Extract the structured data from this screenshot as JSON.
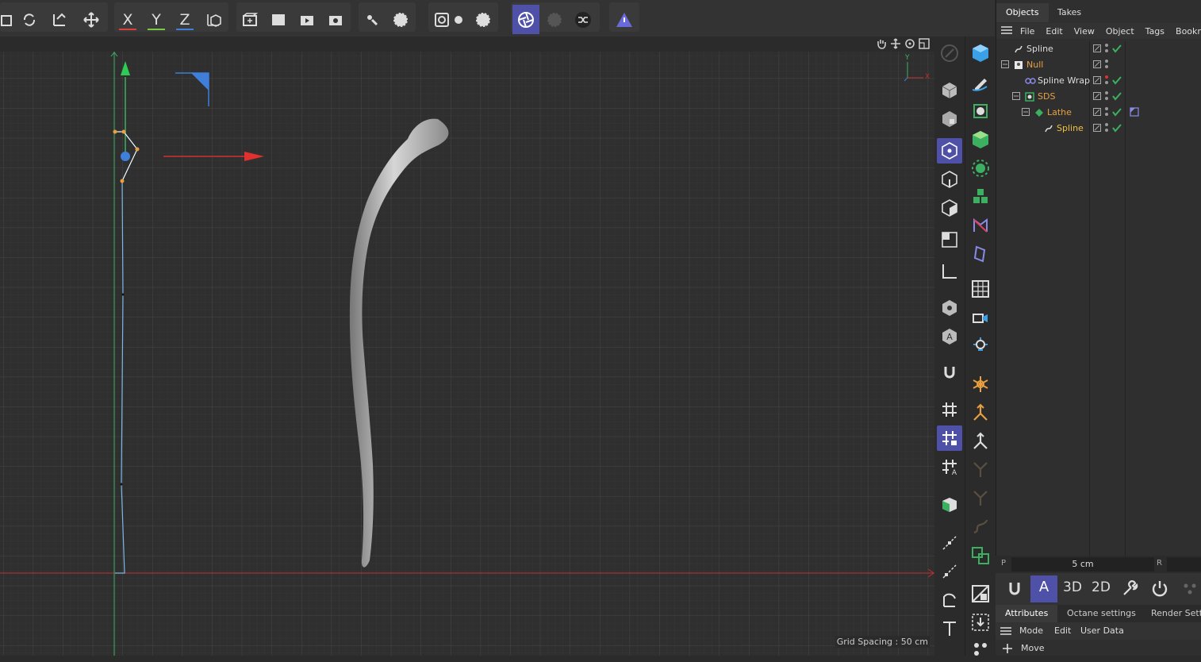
{
  "toolbar": {
    "axis_x": "X",
    "axis_y": "Y",
    "axis_z": "Z",
    "colors": {
      "x": "#d94040",
      "y": "#7ac943",
      "z": "#3f7fd9",
      "active": "#4f50a8"
    }
  },
  "viewport": {
    "grid_spacing": "Grid Spacing : 50 cm",
    "axis_y_label": "Y",
    "axis_x_label": "X"
  },
  "objects_panel": {
    "tabs": [
      "Objects",
      "Takes"
    ],
    "menu": [
      "File",
      "Edit",
      "View",
      "Object",
      "Tags",
      "Bookmar"
    ],
    "rows": [
      {
        "name": "Spline",
        "color": "#dddddd",
        "indent": 0,
        "icon": "spline-icon"
      },
      {
        "name": "Null",
        "color": "#e8a040",
        "indent": 0,
        "icon": "null-icon"
      },
      {
        "name": "Spline Wrap",
        "color": "#dddddd",
        "indent": 1,
        "icon": "spline-wrap-icon"
      },
      {
        "name": "SDS",
        "color": "#e8a040",
        "indent": 1,
        "icon": "sds-icon"
      },
      {
        "name": "Lathe",
        "color": "#e8a040",
        "indent": 2,
        "icon": "lathe-icon"
      },
      {
        "name": "Spline",
        "color": "#f0c040",
        "indent": 3,
        "icon": "spline-icon"
      }
    ]
  },
  "coords": {
    "p_label": "P",
    "value": "5 cm",
    "r_label": "R"
  },
  "mode_bar": {
    "labels": [
      "3D",
      "2D"
    ],
    "active_label": "A"
  },
  "attributes": {
    "tabs": [
      "Attributes",
      "Octane settings",
      "Render Setti"
    ],
    "menu": [
      "Mode",
      "Edit",
      "User Data"
    ],
    "move_label": "Move"
  }
}
